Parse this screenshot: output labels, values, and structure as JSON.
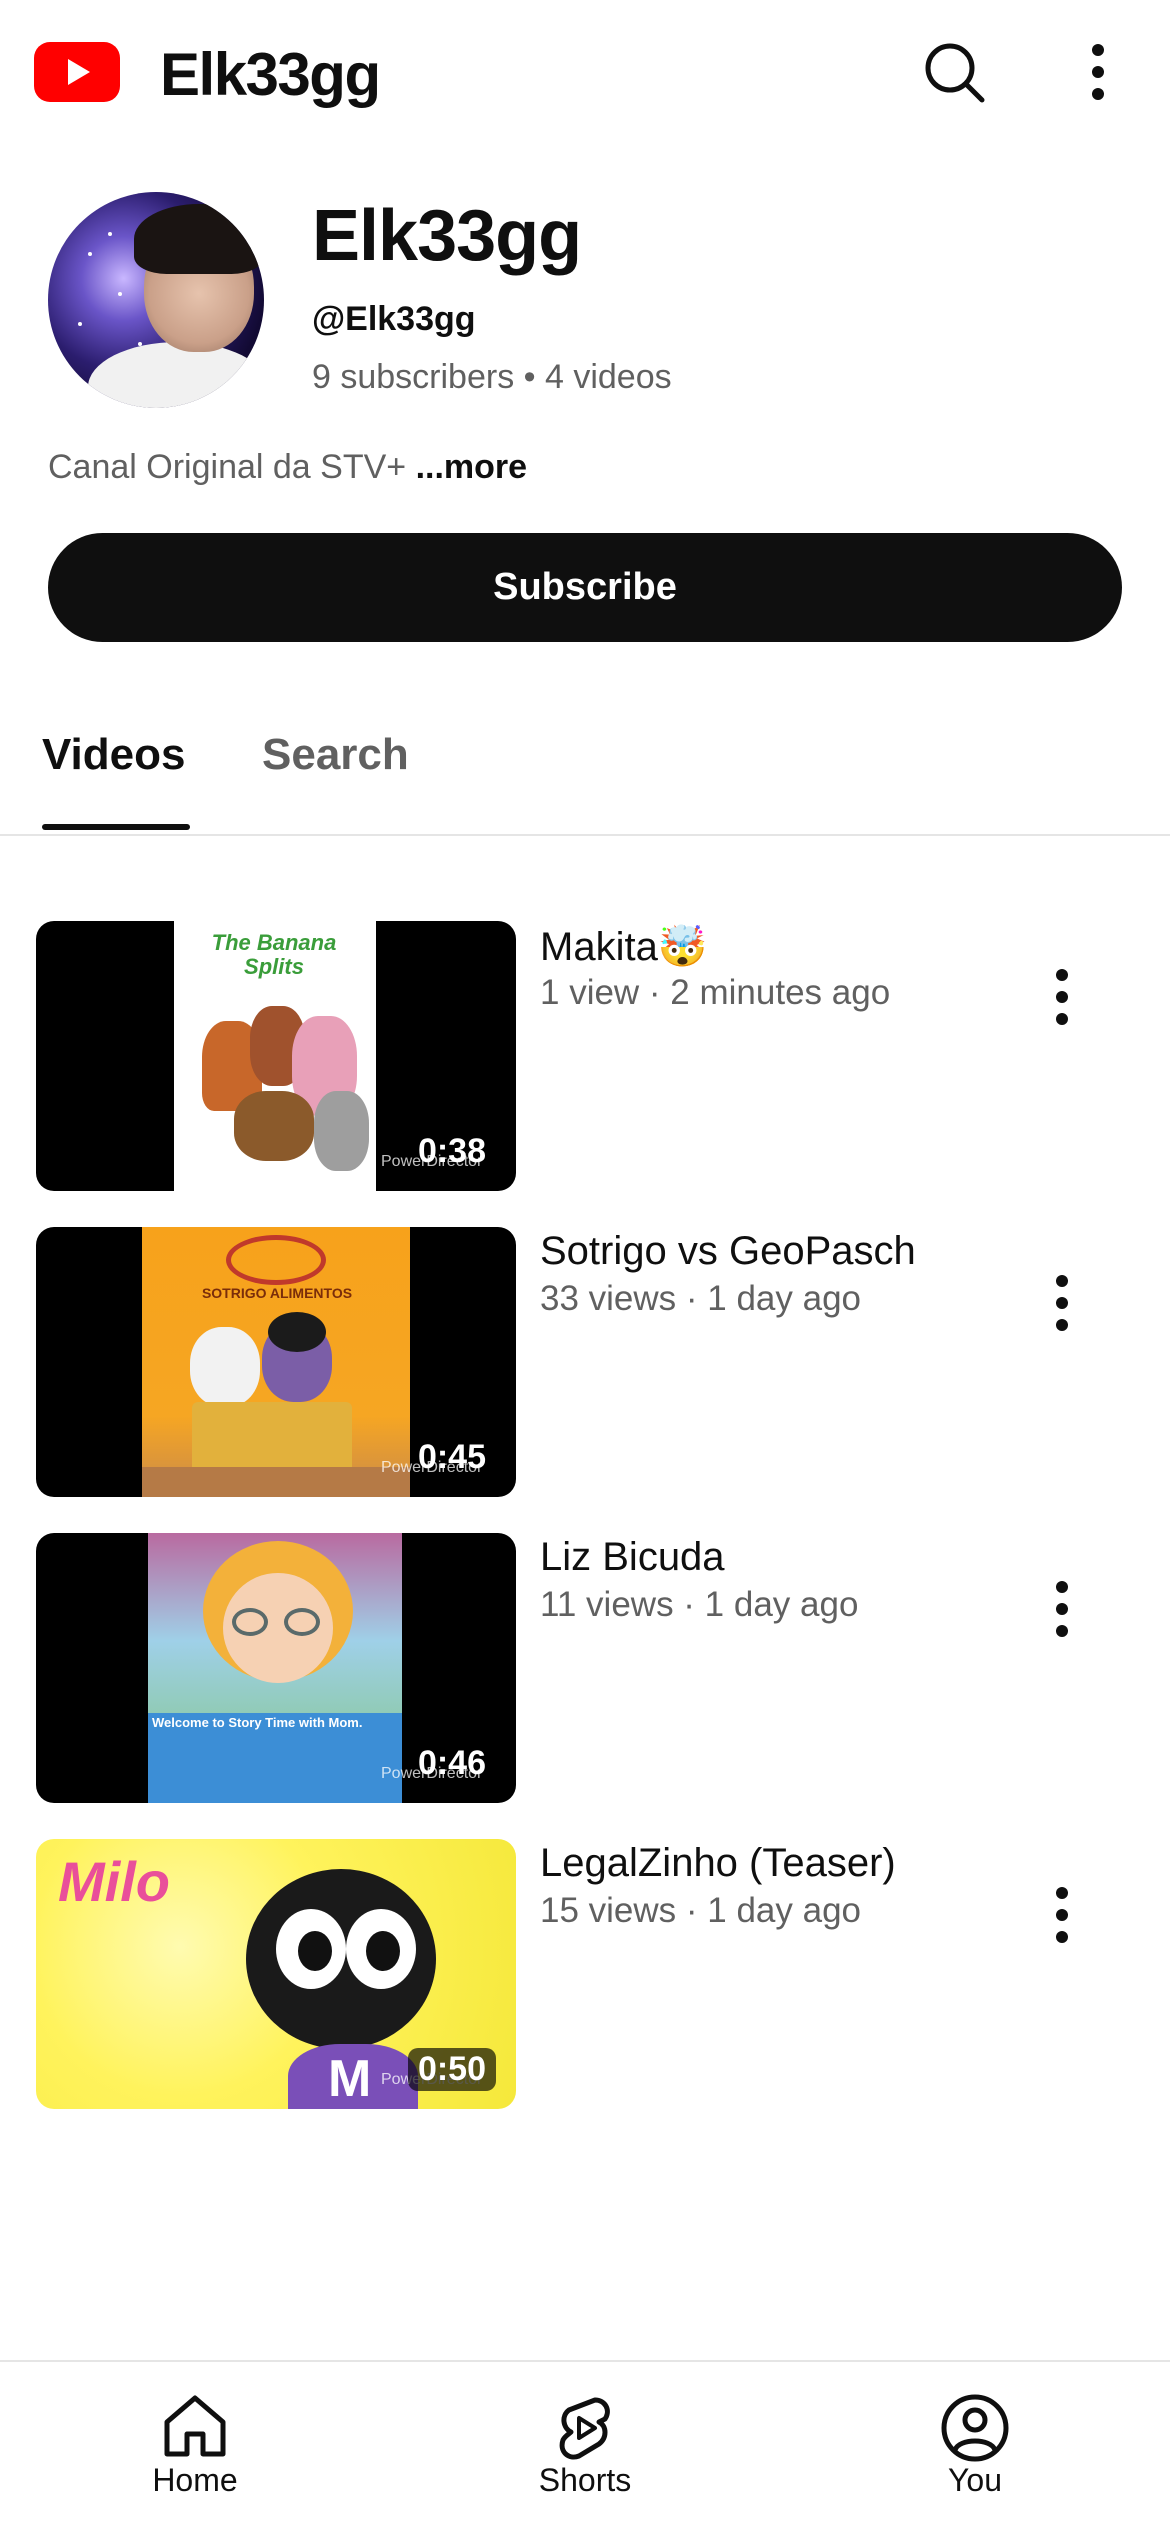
{
  "header": {
    "brand": "Elk33gg",
    "icons": [
      "youtube-logo-icon",
      "search-icon",
      "more-vertical-icon"
    ]
  },
  "channel": {
    "name": "Elk33gg",
    "handle": "@Elk33gg",
    "stats": "9 subscribers • 4 videos",
    "description": "Canal Original da STV+",
    "more_label": "...more",
    "subscribe_label": "Subscribe"
  },
  "tabs": [
    {
      "label": "Videos",
      "active": true
    },
    {
      "label": "Search",
      "active": false
    }
  ],
  "videos": [
    {
      "title": "Makita🤯",
      "meta": "1 view · 2 minutes ago",
      "duration": "0:38",
      "watermark": "PowerDirector"
    },
    {
      "title": "Sotrigo vs GeoPasch",
      "meta": "33 views · 1 day ago",
      "duration": "0:45",
      "watermark": "PowerDirector"
    },
    {
      "title": "Liz Bicuda",
      "meta": "11 views · 1 day ago",
      "duration": "0:46",
      "watermark": "PowerDirector"
    },
    {
      "title": "LegalZinho (Teaser)",
      "meta": "15 views · 1 day ago",
      "duration": "0:50",
      "watermark": "PowerDirector"
    }
  ],
  "thumb_text": {
    "banana_splits": "The Banana Splits",
    "sotrigo_brand": "SOTRIGO ALIMENTOS",
    "story_time": "Welcome to Story Time with Mom.",
    "milo": "Milo",
    "milo_letter": "M"
  },
  "bottom_nav": [
    {
      "label": "Home",
      "icon": "home-icon"
    },
    {
      "label": "Shorts",
      "icon": "shorts-icon"
    },
    {
      "label": "You",
      "icon": "account-icon"
    }
  ],
  "colors": {
    "youtube_red": "#ff0000",
    "text_primary": "#0f0f0f",
    "text_secondary": "#606060",
    "divider": "#e5e5e5"
  }
}
